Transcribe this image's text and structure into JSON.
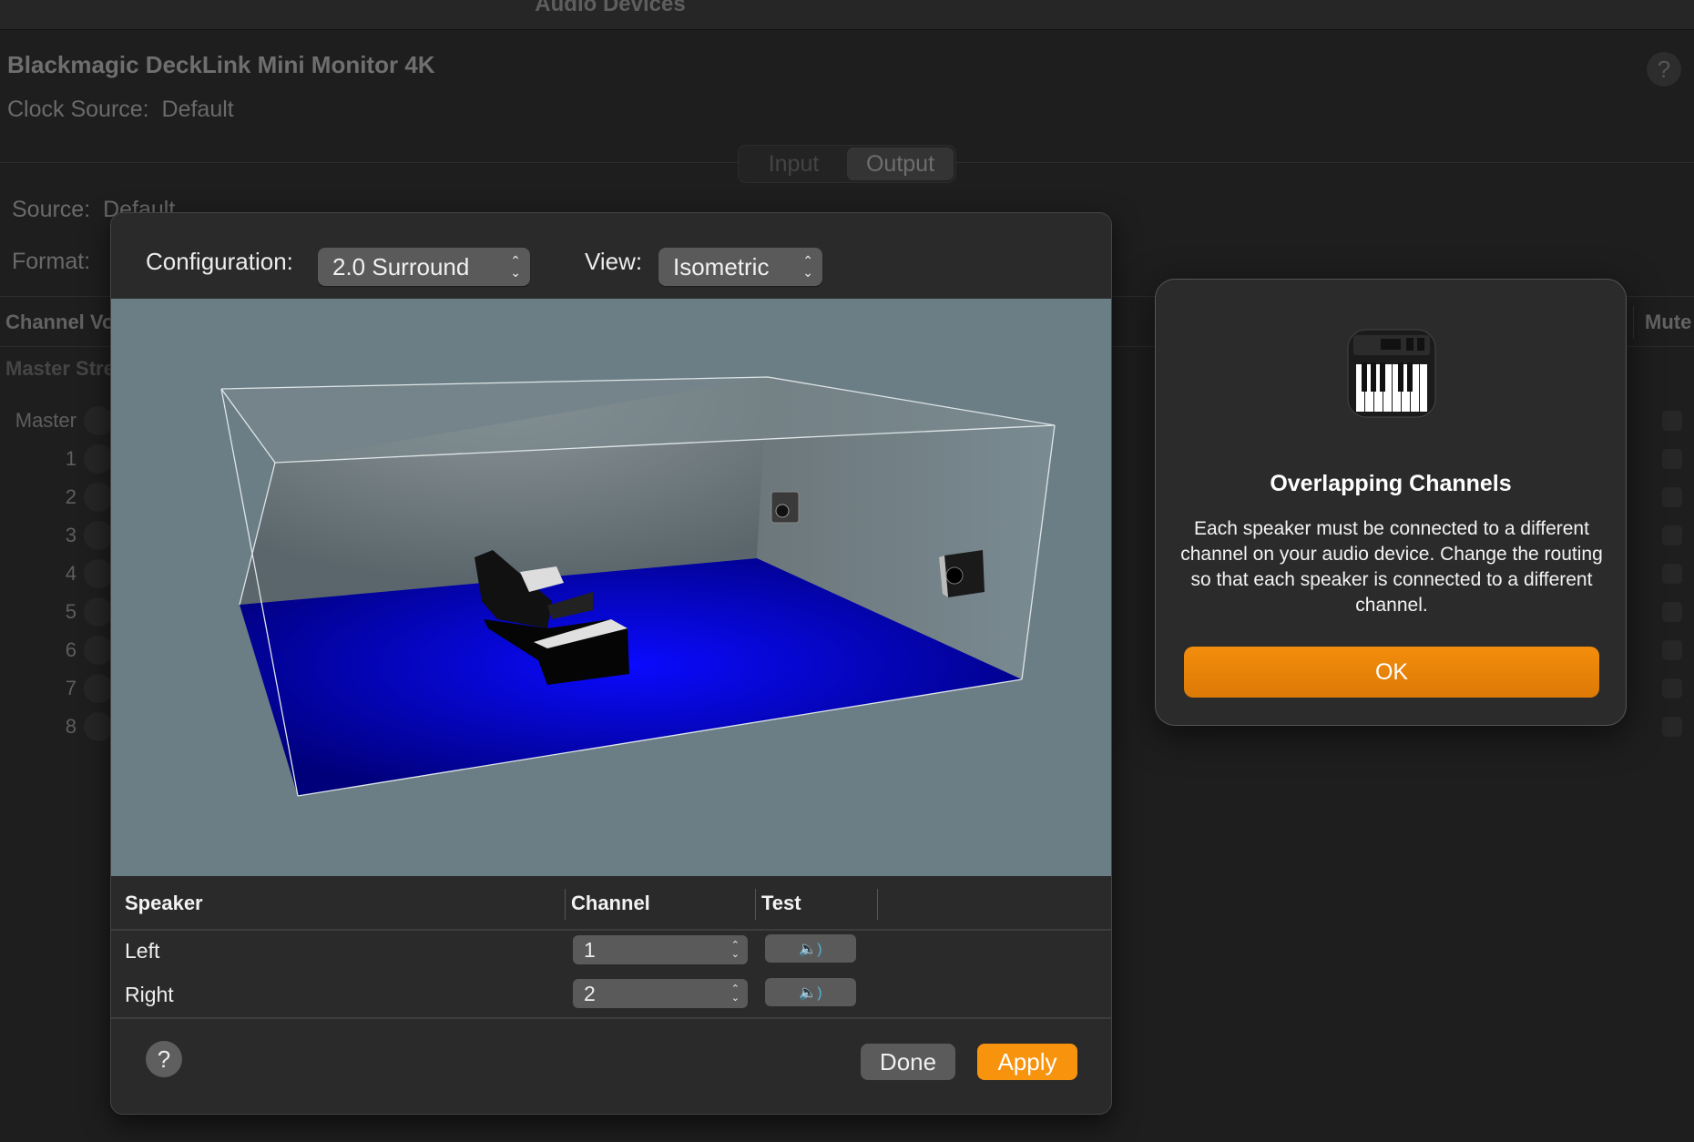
{
  "window": {
    "title": "Audio Devices"
  },
  "device": {
    "name": "Blackmagic DeckLink Mini Monitor 4K",
    "clock_label": "Clock Source:",
    "clock_value": "Default",
    "source_label": "Source:",
    "source_value": "Default",
    "format_label": "Format:"
  },
  "segmented": {
    "input": "Input",
    "output": "Output",
    "selected": "Output"
  },
  "channels": {
    "header": "Channel Volume",
    "mute_header": "Mute",
    "section": "Master Stream",
    "rows": [
      "Master",
      "1",
      "2",
      "3",
      "4",
      "5",
      "6",
      "7",
      "8"
    ]
  },
  "sheet": {
    "config_label": "Configuration:",
    "config_value": "2.0 Surround",
    "view_label": "View:",
    "view_value": "Isometric",
    "table": {
      "headers": [
        "Speaker",
        "Channel",
        "Test"
      ],
      "rows": [
        {
          "speaker": "Left",
          "channel": "1"
        },
        {
          "speaker": "Right",
          "channel": "2"
        }
      ]
    },
    "help": "?",
    "done": "Done",
    "apply": "Apply"
  },
  "alert": {
    "title": "Overlapping Channels",
    "body": "Each speaker must be connected to a different channel on your audio device. Change the routing so that each speaker is connected to a different channel.",
    "ok": "OK",
    "icon": "audio-midi-setup-piano-icon"
  },
  "help": "?",
  "colors": {
    "accent": "#f38d0c",
    "floor": "#0000c8",
    "scene_bg": "#6b7e86"
  }
}
